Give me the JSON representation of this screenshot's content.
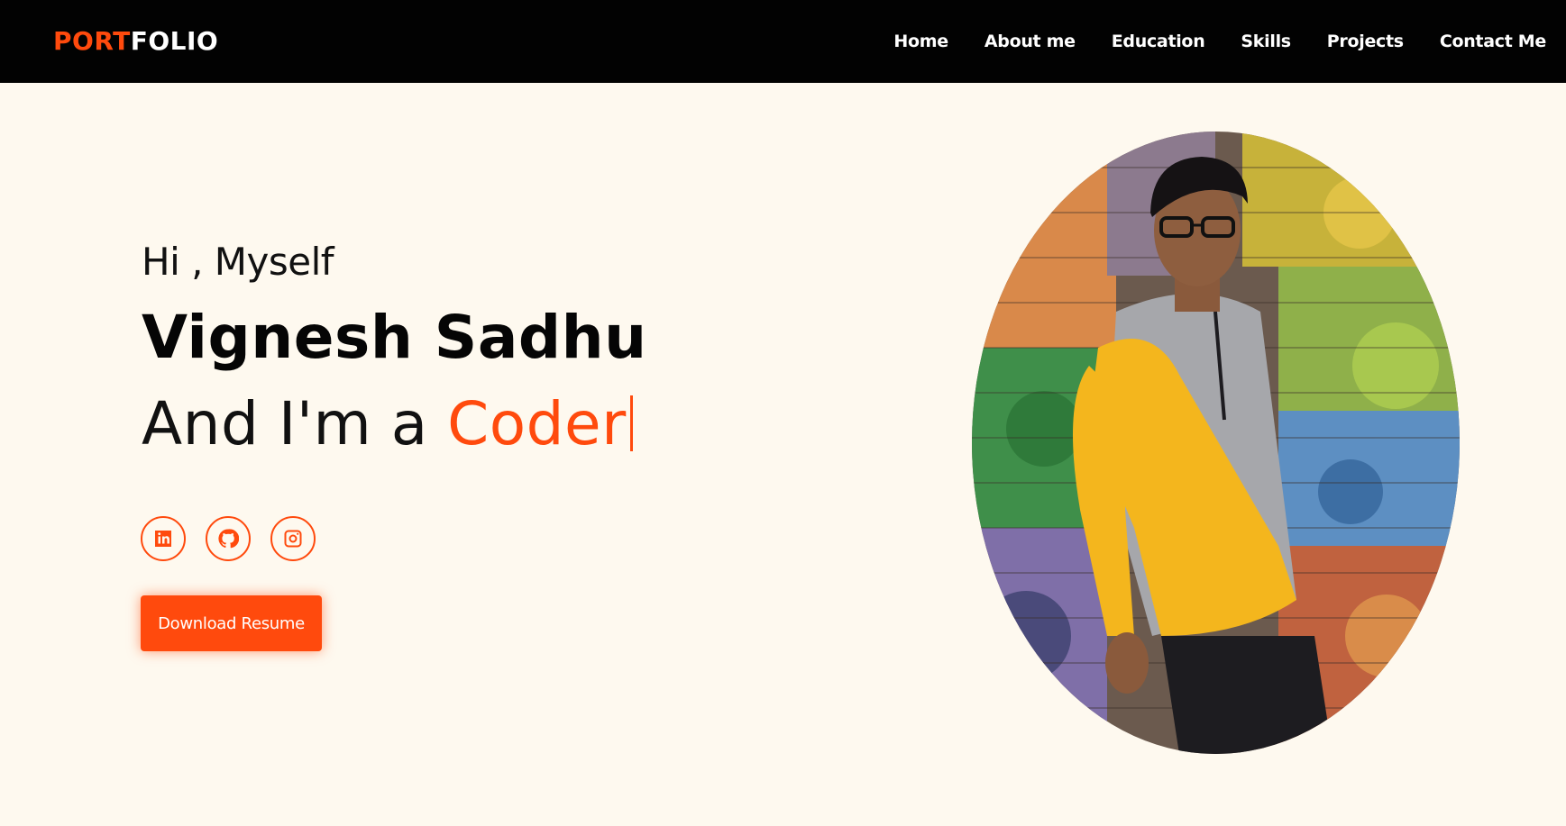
{
  "brand": {
    "accent": "PORT",
    "rest": "FOLIO",
    "accent_color": "#ff4a0d"
  },
  "nav": {
    "items": [
      {
        "label": "Home"
      },
      {
        "label": "About me"
      },
      {
        "label": "Education"
      },
      {
        "label": "Skills"
      },
      {
        "label": "Projects"
      },
      {
        "label": "Contact Me"
      }
    ]
  },
  "hero": {
    "greeting": "Hi , Myself",
    "name": "Vignesh Sadhu",
    "tagline_prefix": "And I'm a ",
    "role": "Coder",
    "download_label": "Download Resume"
  },
  "socials": [
    {
      "icon": "linkedin-icon"
    },
    {
      "icon": "github-icon"
    },
    {
      "icon": "instagram-icon"
    }
  ],
  "profile_photo": {
    "icon": "profile-photo"
  },
  "colors": {
    "accent": "#ff4a0d",
    "navbar": "#020202",
    "background": "#fef9ef"
  }
}
